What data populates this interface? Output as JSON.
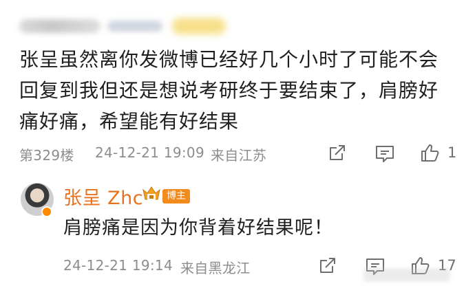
{
  "comment": {
    "text_line1": "张呈虽然离你发微博已经好几个小时了可能不会",
    "text_line2": "回复到我但还是想说考研终于要结束了，肩膀好",
    "text_line3": "痛好痛，希望能有好结果",
    "floor": "第329楼",
    "time": "24-12-21 19:09",
    "location": "来自江苏",
    "like_count": "1",
    "icons": [
      "share-icon",
      "comment-icon",
      "like-icon"
    ]
  },
  "reply": {
    "author_name": "张呈 Zhc",
    "author_badge": "博主",
    "text": "肩膀痛是因为你背着好结果呢！",
    "time": "24-12-21 19:14",
    "location": "来自黑龙江",
    "like_count": "17",
    "icons": [
      "share-icon",
      "comment-icon",
      "like-icon"
    ]
  },
  "colors": {
    "name_accent": "#e8711c",
    "meta_gray": "#8c8c8c",
    "badge_orange": "#f28a1c"
  }
}
